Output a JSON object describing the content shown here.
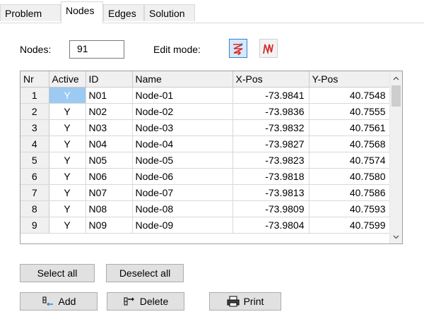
{
  "tabs": [
    {
      "label": "Problem",
      "active": false
    },
    {
      "label": "Nodes",
      "active": true
    },
    {
      "label": "Edges",
      "active": false
    },
    {
      "label": "Solution",
      "active": false
    }
  ],
  "nodes_label": "Nodes:",
  "nodes_count": "91",
  "edit_mode_label": "Edit mode:",
  "edit_mode_buttons": [
    {
      "icon": "zigzag-arrow-icon",
      "selected": true
    },
    {
      "icon": "zigzag-line-icon",
      "selected": false
    }
  ],
  "grid": {
    "columns": [
      "Nr",
      "Active",
      "ID",
      "Name",
      "X-Pos",
      "Y-Pos"
    ],
    "rows": [
      [
        "1",
        "Y",
        "N01",
        "Node-01",
        "-73.9841",
        "40.7548"
      ],
      [
        "2",
        "Y",
        "N02",
        "Node-02",
        "-73.9836",
        "40.7555"
      ],
      [
        "3",
        "Y",
        "N03",
        "Node-03",
        "-73.9832",
        "40.7561"
      ],
      [
        "4",
        "Y",
        "N04",
        "Node-04",
        "-73.9827",
        "40.7568"
      ],
      [
        "5",
        "Y",
        "N05",
        "Node-05",
        "-73.9823",
        "40.7574"
      ],
      [
        "6",
        "Y",
        "N06",
        "Node-06",
        "-73.9818",
        "40.7580"
      ],
      [
        "7",
        "Y",
        "N07",
        "Node-07",
        "-73.9813",
        "40.7586"
      ],
      [
        "8",
        "Y",
        "N08",
        "Node-08",
        "-73.9809",
        "40.7593"
      ],
      [
        "9",
        "Y",
        "N09",
        "Node-09",
        "-73.9804",
        "40.7599"
      ]
    ]
  },
  "buttons": {
    "select_all": "Select all",
    "deselect_all": "Deselect all",
    "add": "Add",
    "delete": "Delete",
    "print": "Print"
  },
  "colors": {
    "mode_active": "#2f7fd6",
    "mode_icon_red": "#d42a2a",
    "cell_focus": "#9ccaf2"
  }
}
